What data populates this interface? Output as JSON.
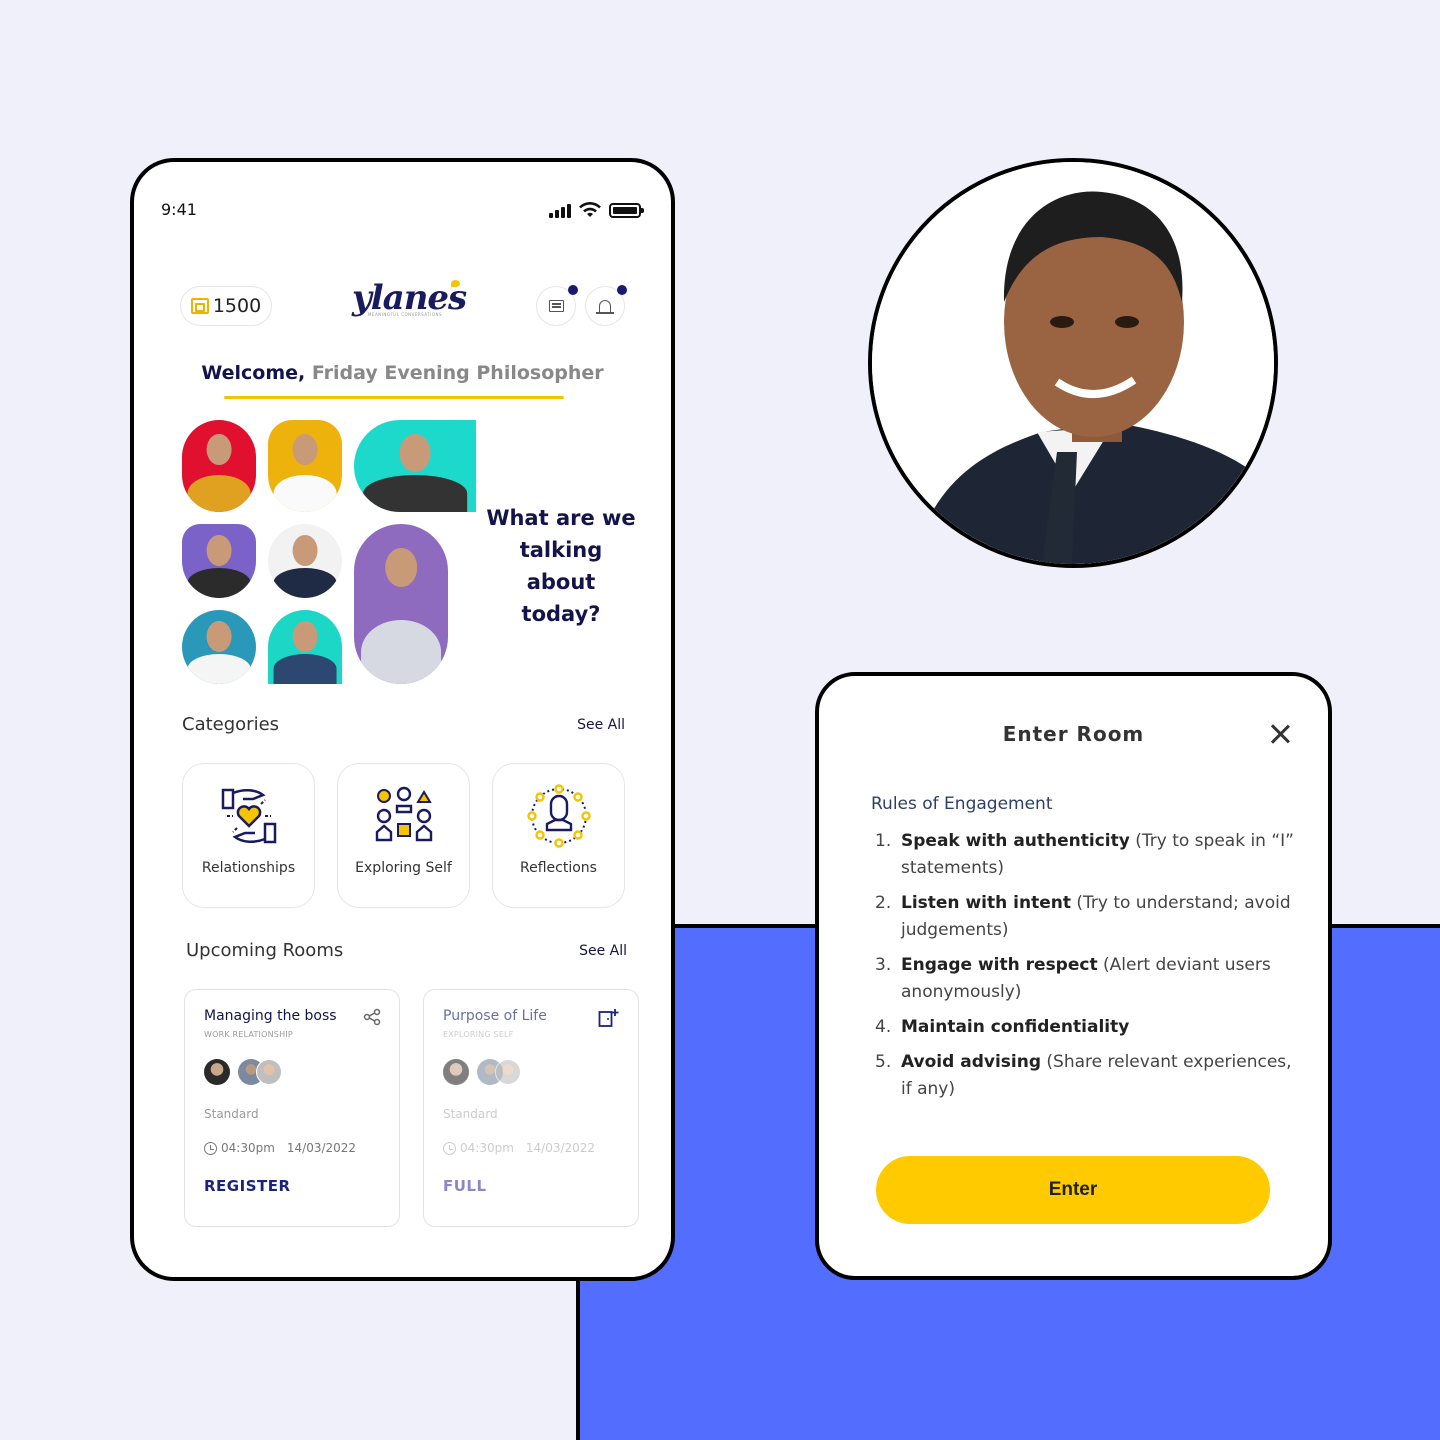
{
  "colors": {
    "background": "#eff0f9",
    "accent_blue": "#536dfe",
    "brand_navy": "#14144a",
    "brand_yellow": "#ffca00"
  },
  "phone": {
    "status_bar": {
      "time": "9:41",
      "icons": [
        "signal-icon",
        "wifi-icon",
        "battery-icon"
      ]
    },
    "header": {
      "wallet_balance": "1500",
      "logo_text": "ylanes",
      "logo_tagline": "MEANINGFUL CONVERSATIONS",
      "chat_has_notification": true,
      "bell_has_notification": true
    },
    "welcome": {
      "greeting": "Welcome,",
      "name": " Friday Evening Philosopher"
    },
    "hero": {
      "question": "What are we talking about today?",
      "avatar_bg_colors": [
        "#e0102e",
        "#edb20c",
        "#1cd9cc",
        "#7b62c9",
        "#f2f2f2",
        "#8e6bbf",
        "#2a98b8",
        "#1cd6c6"
      ]
    },
    "categories": {
      "title": "Categories",
      "see_all": "See All",
      "items": [
        {
          "label": "Relationships",
          "icon": "hands-heart-icon"
        },
        {
          "label": "Exploring Self",
          "icon": "people-shapes-icon"
        },
        {
          "label": "Reflections",
          "icon": "person-circle-icon"
        }
      ]
    },
    "upcoming_rooms": {
      "title": "Upcoming Rooms",
      "see_all": "See All",
      "rooms": [
        {
          "title": "Managing the boss",
          "category": "WORK RELATIONSHIP",
          "tier": "Standard",
          "time": "04:30pm",
          "date": "14/03/2022",
          "action": "REGISTER",
          "corner_icon": "share-icon"
        },
        {
          "title": "Purpose of Life",
          "category": "EXPLORING SELF",
          "tier": "Standard",
          "time": "04:30pm",
          "date": "14/03/2022",
          "action": "FULL",
          "corner_icon": "enter-door-icon"
        }
      ]
    }
  },
  "modal": {
    "title": "Enter Room",
    "rules_title": "Rules of Engagement",
    "rules": [
      {
        "num": "1.",
        "bold": "Speak with authenticity",
        "rest": " (Try to speak in “I” statements)"
      },
      {
        "num": "2.",
        "bold": "Listen with intent",
        "rest": " (Try to understand; avoid judgements)"
      },
      {
        "num": "3.",
        "bold": "Engage with respect",
        "rest": " (Alert deviant users anonymously)"
      },
      {
        "num": "4.",
        "bold": "Maintain confidentiality",
        "rest": ""
      },
      {
        "num": "5.",
        "bold": "Avoid advising",
        "rest": " (Share relevant experiences, if any)"
      }
    ],
    "enter_label": "Enter"
  }
}
